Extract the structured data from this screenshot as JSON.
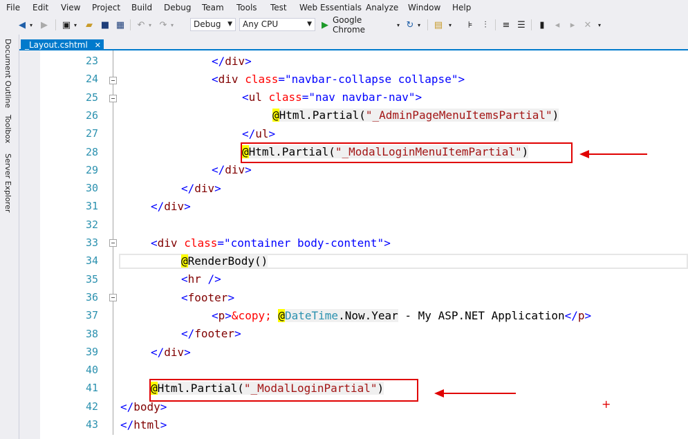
{
  "menu": [
    "File",
    "Edit",
    "View",
    "Project",
    "Build",
    "Debug",
    "Team",
    "Tools",
    "Test",
    "Web Essentials",
    "Analyze",
    "Window",
    "Help"
  ],
  "toolbar": {
    "config": "Debug",
    "platform": "Any CPU",
    "run_target": "Google Chrome"
  },
  "side_tabs": [
    "Document Outline",
    "Toolbox",
    "Server Explorer"
  ],
  "document_tab": {
    "name": "_Layout.cshtml",
    "close": "✕"
  },
  "line_numbers": [
    "23",
    "24",
    "25",
    "26",
    "27",
    "28",
    "29",
    "30",
    "31",
    "32",
    "33",
    "34",
    "35",
    "36",
    "37",
    "38",
    "39",
    "40",
    "41",
    "42",
    "43"
  ],
  "code": {
    "l23": {
      "p1": "</",
      "t1": "div",
      "p2": ">"
    },
    "l24": {
      "p1": "<",
      "t1": "div",
      "a1": "class",
      "p2": "=",
      "v1": "\"navbar-collapse collapse\"",
      "p3": ">"
    },
    "l25": {
      "p1": "<",
      "t1": "ul",
      "a1": "class",
      "p2": "=",
      "v1": "\"nav navbar-nav\"",
      "p3": ">"
    },
    "l26": {
      "at": "@",
      "c1": "Html.Partial(",
      "s1": "\"_AdminPageMenuItemsPartial\"",
      "c2": ")"
    },
    "l27": {
      "p1": "</",
      "t1": "ul",
      "p2": ">"
    },
    "l28": {
      "at": "@",
      "c1": "Html.Partial(",
      "s1": "\"_ModalLoginMenuItemPartial\"",
      "c2": ")"
    },
    "l29": {
      "p1": "</",
      "t1": "div",
      "p2": ">"
    },
    "l30": {
      "p1": "</",
      "t1": "div",
      "p2": ">"
    },
    "l31": {
      "p1": "</",
      "t1": "div",
      "p2": ">"
    },
    "l33": {
      "p1": "<",
      "t1": "div",
      "a1": "class",
      "p2": "=",
      "v1": "\"container body-content\"",
      "p3": ">"
    },
    "l34": {
      "at": "@",
      "c1": "RenderBody()"
    },
    "l35": {
      "p1": "<",
      "t1": "hr",
      "p2": " />"
    },
    "l36": {
      "p1": "<",
      "t1": "footer",
      "p2": ">"
    },
    "l37": {
      "p1": "<",
      "t1": "p",
      "p2": ">",
      "t2": "&copy;",
      "p3": " ",
      "at": "@",
      "k1": "DateTime",
      "c1": ".Now.Year",
      "p4": " - My ASP.NET Application",
      "p5": "</",
      "t3": "p",
      "p6": ">"
    },
    "l38": {
      "p1": "</",
      "t1": "footer",
      "p2": ">"
    },
    "l39": {
      "p1": "</",
      "t1": "div",
      "p2": ">"
    },
    "l41": {
      "at": "@",
      "c1": "Html.Partial(",
      "s1": "\"_ModalLoginPartial\"",
      "c2": ")"
    },
    "l42": {
      "p1": "</",
      "t1": "body",
      "p2": ">"
    },
    "l43": {
      "p1": "</",
      "t1": "html",
      "p2": ">"
    }
  },
  "colors": {
    "accent": "#007acc",
    "annotation": "#e00000"
  }
}
